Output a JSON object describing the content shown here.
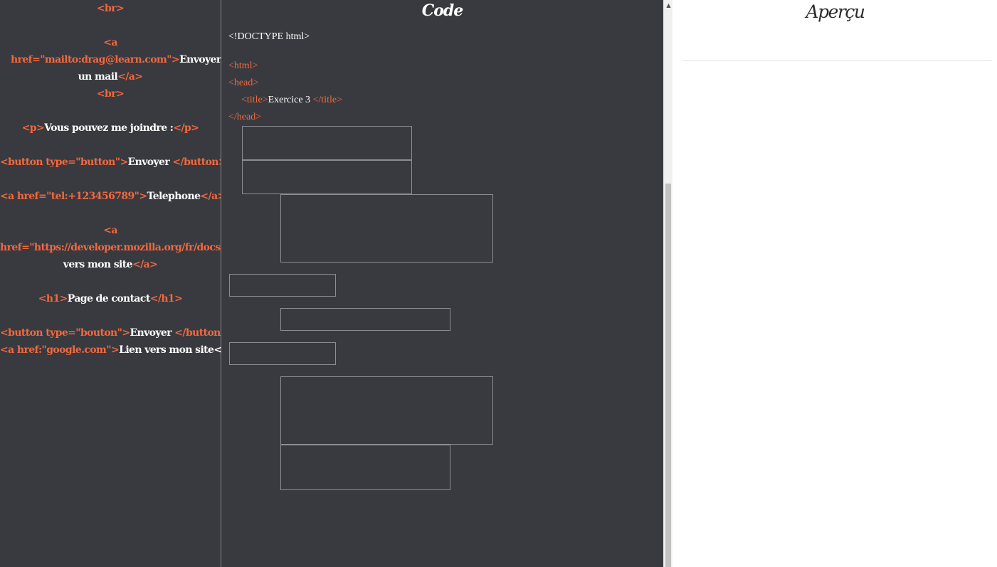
{
  "palette": {
    "items": [
      {
        "open": "<br>",
        "text": "",
        "close": ""
      },
      {
        "open": "<a href=\"mailto:drag@learn.com\">",
        "text": "Envoyer un mail",
        "close": "</a>"
      },
      {
        "open": "<br>",
        "text": "",
        "close": ""
      },
      {
        "open": "<p>",
        "text": "Vous pouvez me joindre :",
        "close": "</p>"
      },
      {
        "open": "<button type=\"button\">",
        "text": "Envoyer ",
        "close": "</button>"
      },
      {
        "open": "<a href=\"tel:+123456789\">",
        "text": "Telephone",
        "close": "</a>"
      },
      {
        "open": "<a href=\"https://developer.mozilla.org/fr/docs/Web/HTTP\">",
        "text": "Lien vers mon site",
        "close": "</a>"
      },
      {
        "open": "<h1>",
        "text": "Page de contact",
        "close": "</h1>"
      },
      {
        "open": "<button type=\"bouton\">",
        "text": "Envoyer ",
        "close": "</button>"
      },
      {
        "open": "<a href:\"google.com\">",
        "text": "Lien vers mon site</a>",
        "close": ""
      }
    ]
  },
  "code": {
    "title": "Code",
    "doctype": "<!DOCTYPE html>",
    "html_open": "<html>",
    "head_open": "<head>",
    "title_open": "<title>",
    "title_text": "Exercice 3 ",
    "title_close": "</title>",
    "head_close": "</head>"
  },
  "preview": {
    "title": "Aperçu"
  },
  "colors": {
    "panel_bg": "#393a3f",
    "tag": "#f2683f",
    "text": "#ffffff",
    "drop_border": "#8d8d90"
  }
}
